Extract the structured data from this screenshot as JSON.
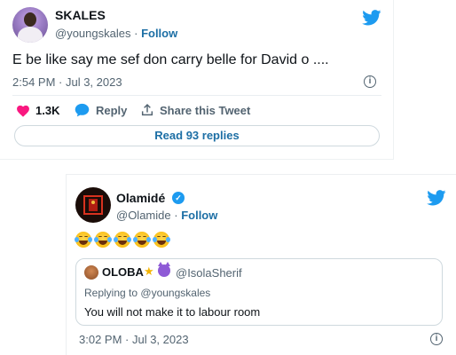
{
  "tweet1": {
    "display_name": "SKALES",
    "handle": "@youngskales",
    "separator": "·",
    "follow_label": "Follow",
    "text": "E be like say me sef don carry belle for David o ....",
    "timestamp": "2:54 PM · Jul 3, 2023",
    "likes_count": "1.3K",
    "reply_label": "Reply",
    "share_label": "Share this Tweet",
    "read_replies_label": "Read 93 replies"
  },
  "tweet2": {
    "display_name": "Olamidé",
    "verified": true,
    "handle": "@Olamide",
    "separator": "·",
    "follow_label": "Follow",
    "emojis": [
      "face-with-tears-of-joy",
      "face-with-tears-of-joy",
      "face-with-tears-of-joy",
      "face-with-tears-of-joy",
      "face-with-tears-of-joy"
    ],
    "timestamp": "3:02 PM · Jul 3, 2023",
    "quoted": {
      "display_name": "OLOBA",
      "badges": [
        "star-emoji",
        "smiling-devil-emoji"
      ],
      "handle": "@IsolaSherif",
      "replying_prefix": "Replying to",
      "replying_to": "@youngskales",
      "text": "You will not make it to labour room"
    }
  },
  "colors": {
    "twitter_blue": "#1d9bf0",
    "follow_link": "#1d6fa5",
    "like_red": "#f91880",
    "secondary_text": "#536471"
  }
}
